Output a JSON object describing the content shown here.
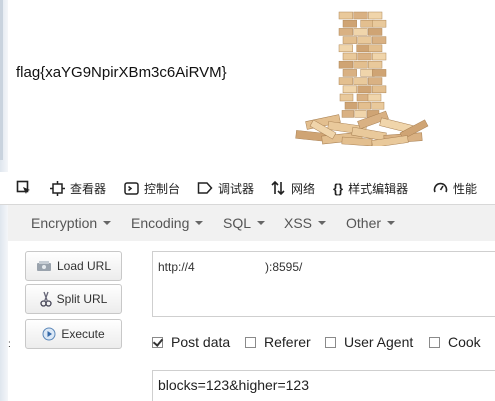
{
  "flag": "flag{xaYG9NpirXBm3c6AiRVM}",
  "devtools": {
    "items": [
      {
        "label": "",
        "icon": "pick-element-icon"
      },
      {
        "label": "查看器",
        "icon": "inspector-icon"
      },
      {
        "label": "控制台",
        "icon": "console-icon"
      },
      {
        "label": "调试器",
        "icon": "debugger-icon"
      },
      {
        "label": "网络",
        "icon": "network-icon"
      },
      {
        "label": "样式编辑器",
        "icon": "style-editor-icon"
      },
      {
        "label": "性能",
        "icon": "performance-icon"
      }
    ]
  },
  "menu": {
    "items": [
      "Encryption",
      "Encoding",
      "SQL",
      "XSS",
      "Other"
    ]
  },
  "buttons": {
    "load": "Load URL",
    "split": "Split URL",
    "execute": "Execute"
  },
  "url": {
    "prefix": "http://4",
    "suffix": "):8595/"
  },
  "options": [
    {
      "label": "Post data",
      "checked": true
    },
    {
      "label": "Referer",
      "checked": false
    },
    {
      "label": "User Agent",
      "checked": false
    },
    {
      "label": "Cook",
      "checked": false
    }
  ],
  "post_data": "blocks=123&higher=123",
  "side_mark": ":"
}
